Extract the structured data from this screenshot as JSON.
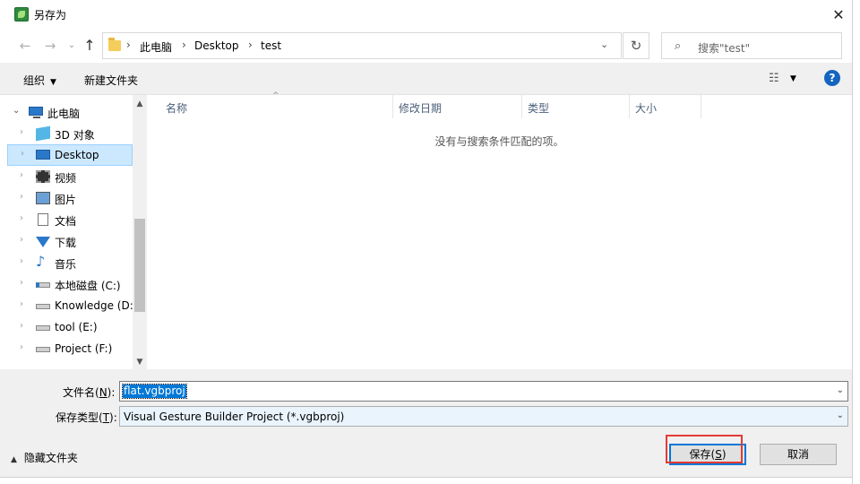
{
  "window": {
    "title": "另存为",
    "close_glyph": "✕"
  },
  "address": {
    "crumbs": [
      "此电脑",
      "Desktop",
      "test"
    ],
    "search_placeholder": "搜索\"test\""
  },
  "toolbar": {
    "organize": "组织",
    "new_folder": "新建文件夹",
    "help": "?"
  },
  "tree": [
    {
      "label": "此电脑",
      "icon": "computer-icon",
      "root": true
    },
    {
      "label": "3D 对象",
      "icon": "3d-objects-icon"
    },
    {
      "label": "Desktop",
      "icon": "desktop-icon",
      "selected": true
    },
    {
      "label": "视频",
      "icon": "video-icon"
    },
    {
      "label": "图片",
      "icon": "pictures-icon"
    },
    {
      "label": "文档",
      "icon": "documents-icon"
    },
    {
      "label": "下载",
      "icon": "downloads-icon"
    },
    {
      "label": "音乐",
      "icon": "music-icon"
    },
    {
      "label": "本地磁盘 (C:)",
      "icon": "drive-c-icon"
    },
    {
      "label": "Knowledge (D:",
      "icon": "drive-icon"
    },
    {
      "label": "tool (E:)",
      "icon": "drive-icon"
    },
    {
      "label": "Project (F:)",
      "icon": "drive-icon"
    }
  ],
  "columns": [
    "名称",
    "修改日期",
    "类型",
    "大小"
  ],
  "empty_message": "没有与搜索条件匹配的项。",
  "form": {
    "filename_label": "文件名(",
    "filename_key": "N",
    "filename_label_end": "):",
    "filename_value": "flat.vgbproj",
    "filetype_label": "保存类型(",
    "filetype_key": "T",
    "filetype_label_end": "):",
    "filetype_value": "Visual Gesture Builder Project (*.vgbproj)"
  },
  "footer": {
    "hide_folders": "隐藏文件夹",
    "save_label": "保存(",
    "save_key": "S",
    "save_label_end": ")",
    "cancel": "取消"
  },
  "colors": {
    "accent": "#0078d7",
    "selection": "#cce8ff",
    "highlight_box": "#e53935"
  }
}
